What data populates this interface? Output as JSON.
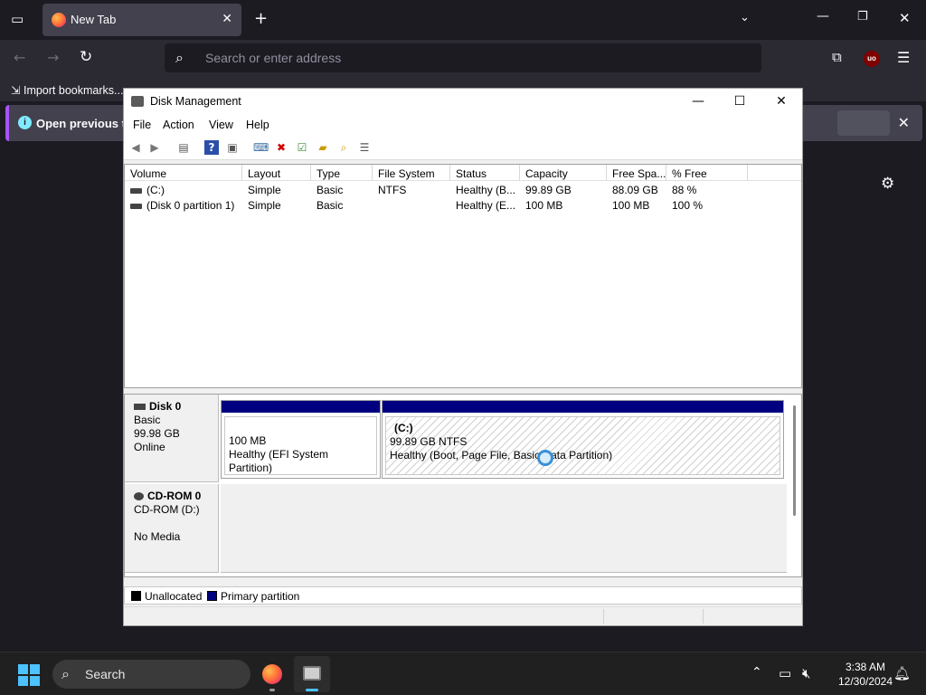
{
  "browser": {
    "tab_title": "New Tab",
    "url_placeholder": "Search or enter address",
    "bookmark_import": "Import bookmarks...",
    "infobar_text": "Open previous tabs?",
    "extension_badge": "uo"
  },
  "window": {
    "title": "Disk Management",
    "menu": [
      "File",
      "Action",
      "View",
      "Help"
    ],
    "columns": [
      "Volume",
      "Layout",
      "Type",
      "File System",
      "Status",
      "Capacity",
      "Free Spa...",
      "% Free"
    ],
    "volumes": [
      {
        "volume": "(C:)",
        "layout": "Simple",
        "type": "Basic",
        "fs": "NTFS",
        "status": "Healthy (B...",
        "capacity": "99.89 GB",
        "free": "88.09 GB",
        "pct": "88 %"
      },
      {
        "volume": "(Disk 0 partition 1)",
        "layout": "Simple",
        "type": "Basic",
        "fs": "",
        "status": "Healthy (E...",
        "capacity": "100 MB",
        "free": "100 MB",
        "pct": "100 %"
      }
    ],
    "disk0": {
      "name": "Disk 0",
      "type": "Basic",
      "size": "99.98 GB",
      "state": "Online",
      "partitions": [
        {
          "label": "",
          "size": "100 MB",
          "status": "Healthy (EFI System Partition)"
        },
        {
          "label": "(C:)",
          "size": "99.89 GB NTFS",
          "status": "Healthy (Boot, Page File, Basic Data Partition)"
        }
      ]
    },
    "cdrom": {
      "name": "CD-ROM 0",
      "type": "CD-ROM (D:)",
      "state": "No Media"
    },
    "legend": {
      "unallocated": "Unallocated",
      "primary": "Primary partition"
    },
    "colors": {
      "primary_bar": "#000080",
      "unallocated": "#000000"
    }
  },
  "taskbar": {
    "search_label": "Search",
    "time": "3:38 AM",
    "date": "12/30/2024"
  }
}
